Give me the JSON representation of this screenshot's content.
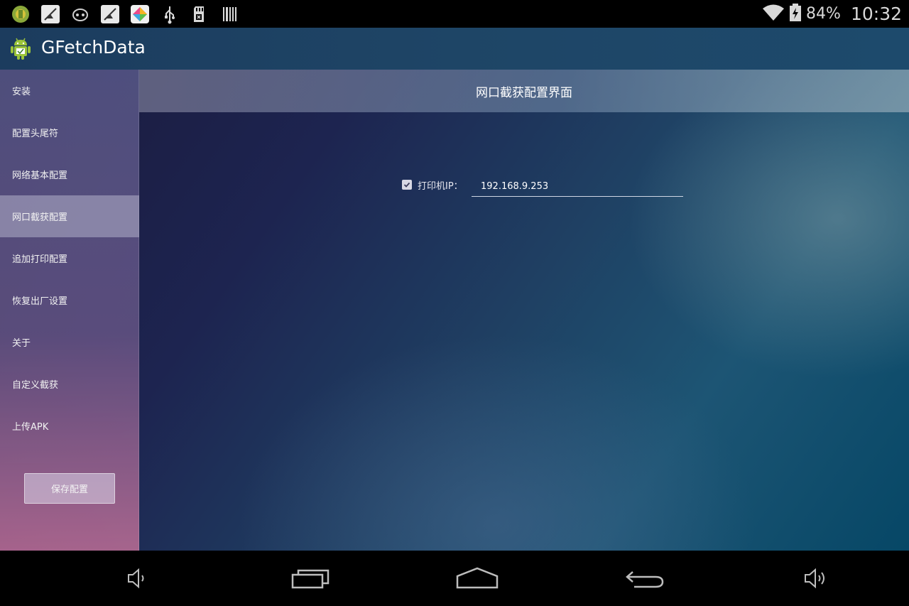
{
  "status_bar": {
    "notification_icons": [
      "android-app-icon",
      "no-signal-icon",
      "robot-icon",
      "no-signal-icon",
      "color-app-icon",
      "usb-icon",
      "sd-card-icon",
      "barcode-icon"
    ],
    "battery_percent": "84%",
    "time": "10:32"
  },
  "app": {
    "title": "GFetchData"
  },
  "sidebar": {
    "items": [
      {
        "label": "安装"
      },
      {
        "label": "配置头尾符"
      },
      {
        "label": "网络基本配置"
      },
      {
        "label": "网口截获配置"
      },
      {
        "label": "追加打印配置"
      },
      {
        "label": "恢复出厂设置"
      },
      {
        "label": "关于"
      },
      {
        "label": "自定义截获"
      },
      {
        "label": "上传APK"
      }
    ],
    "active_index": 3,
    "save_button": "保存配置"
  },
  "content": {
    "title": "网口截获配置界面",
    "printer_ip": {
      "checked": true,
      "label": "打印机IP：",
      "value": "192.168.9.253"
    }
  },
  "nav_bar": {
    "buttons": [
      "volume-down-icon",
      "recent-apps-icon",
      "home-icon",
      "back-icon",
      "volume-up-icon"
    ]
  },
  "colors": {
    "action_bar": "#1e4566",
    "status_bar": "#000000",
    "sidebar_active": "#9a9ab4"
  }
}
